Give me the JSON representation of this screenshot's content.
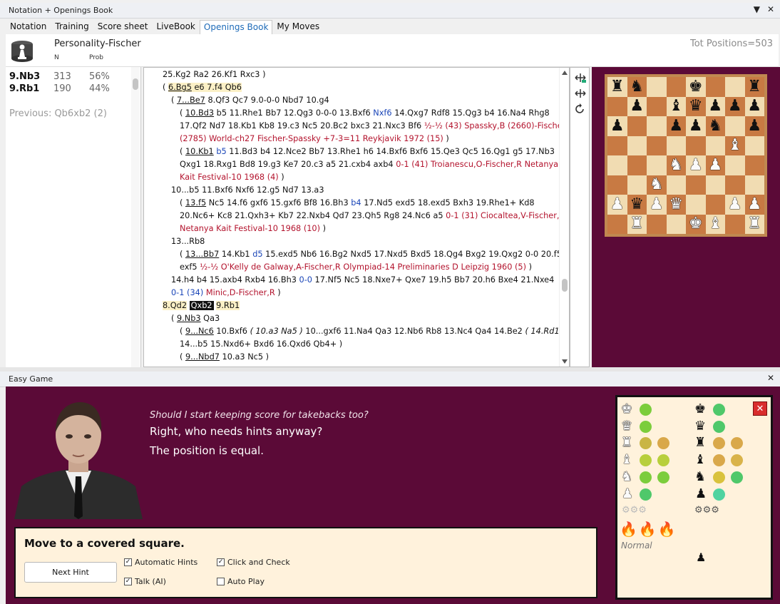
{
  "top_panel": {
    "title": "Notation + Openings Book",
    "pin_icon": "▼",
    "close_icon": "✕",
    "tabs": [
      "Notation",
      "Training",
      "Score sheet",
      "LiveBook",
      "Openings Book",
      "My Moves"
    ],
    "active_tab": "Openings Book"
  },
  "book": {
    "name": "Personality-Fischer",
    "col_n": "N",
    "col_prob": "Prob",
    "tot_positions": "Tot Positions=503",
    "moves": [
      {
        "move": "9.Nb3",
        "n": "313",
        "prob": "56%"
      },
      {
        "move": "9.Rb1",
        "n": "190",
        "prob": "44%"
      }
    ],
    "previous": "Previous: Qb6xb2 (2)"
  },
  "notation": {
    "l1": "25.Kg2  Ra2  26.Kf1  Rxc3 )",
    "l2_open": "( ",
    "l2_m1": "6.Bg5",
    "l2_m2": " e6  7.f4  Qb6",
    "l3_open": "( ",
    "l3_m1": "7...Be7",
    "l3_rest": "  8.Qf3  Qc7  9.0-0-0  Nbd7  10.g4",
    "l4_open": "( ",
    "l4_m1": "10.Bd3",
    "l4_rest": "  b5  11.Rhe1  Bb7  12.Qg3  0-0-0  13.Bxf6  ",
    "l4_blue": "Nxf6",
    "l4_end": "  14.Qxg7  Rdf8  15.Qg3  b4  16.Na4  Rhg8",
    "l5_a": "17.Qf2  Nd7  18.Kb1  Kb8  19.c3  Nc5  20.Bc2  bxc3  21.Nxc3  Bf6 ",
    "l5_red": "½-½ (43) Spassky,B (2660)-Fischer,R",
    "l6_red": "(2785) World-ch27 Fischer-Spassky +7-3=11 Reykjavik 1972 (15)",
    "l6_end": " )",
    "l7_open": "( ",
    "l7_m1": "10.Kb1",
    "l7_sp": "  ",
    "l7_blue": "b5",
    "l7_rest": "  11.Bd3  b4  12.Nce2  Bb7  13.Rhe1  h6  14.Bxf6  Bxf6  15.Qe3  Qc5  16.Qg1  g5  17.Nb3",
    "l8_a": "Qxg1  18.Rxg1  Bd8  19.g3  Ke7  20.c3  a5  21.cxb4  axb4 ",
    "l8_red": "0-1 (41) Troianescu,O-Fischer,R Netanya",
    "l9_red": "Kait Festival-10 1968 (4)",
    "l9_end": " )",
    "l10": "10...b5  11.Bxf6  Nxf6  12.g5  Nd7  13.a3",
    "l11_open": "( ",
    "l11_m1": "13.f5",
    "l11_a": "  Nc5  14.f6  gxf6  15.gxf6  Bf8  16.Bh3  ",
    "l11_blue": "b4",
    "l11_b": "  17.Nd5  exd5  18.exd5  Bxh3  19.Rhe1+  Kd8",
    "l12_a": "20.Nc6+  Kc8  21.Qxh3+  Kb7  22.Nxb4  Qd7  23.Qh5  Rg8  24.Nc6  a5 ",
    "l12_red": "0-1 (31) Ciocaltea,V-Fischer,R",
    "l13_red": "Netanya Kait Festival-10 1968 (10)",
    "l13_end": "  )",
    "l14": "13...Rb8",
    "l15_open": "( ",
    "l15_m1": "13...Bb7",
    "l15_a": "  14.Kb1  ",
    "l15_blue": "d5",
    "l15_b": "  15.exd5  Nb6  16.Bg2  Nxd5  17.Nxd5  Bxd5  18.Qg4  Bxg2  19.Qxg2  0-0  20.f5",
    "l16_a": "exf5 ",
    "l16_red": "½-½ O'Kelly de Galway,A-Fischer,R Olympiad-14 Preliminaries D Leipzig 1960 (5)",
    "l16_end": "  )",
    "l17": "14.h4  b4  15.axb4  Rxb4  16.Bh3  ",
    "l17_blue": "0-0",
    "l17_b": "  17.Nf5  Nc5  18.Nxe7+  Qxe7  19.h5  Bb7  20.h6  Bxe4  21.Nxe4",
    "l18_blue": "0-1 (34)",
    "l18_red": " Minic,D-Fischer,R",
    "l18_end": " )",
    "l19_a": "8.Qd2",
    "l19_cur": "Qxb2",
    "l19_b": "9.Rb1",
    "l20_open": "( ",
    "l20_m1": "9.Nb3",
    "l20_b": "  Qa3",
    "l21_open": "( ",
    "l21_m1": "9...Nc6",
    "l21_a": "  10.Bxf6  ",
    "l21_it1": "( 10.a3  Na5 )",
    "l21_b": "  10...gxf6  11.Na4  Qa3  12.Nb6  Rb8  13.Nc4  Qa4  14.Be2  ",
    "l21_it2": "( 14.Rd1 )",
    "l22": "14...b5  15.Nxd6+  Bxd6  16.Qxd6  Qb4+ )",
    "l23_open": "( ",
    "l23_m1": "9...Nbd7",
    "l23_b": "  10.a3  Nc5 )"
  },
  "board": {
    "rows": [
      [
        "r",
        "n",
        "",
        "",
        "k",
        "",
        "",
        "r"
      ],
      [
        "",
        "p",
        "",
        "b",
        "q",
        "p",
        "p",
        "p"
      ],
      [
        "p",
        "",
        "",
        "p",
        "p",
        "n",
        "",
        "p"
      ],
      [
        "",
        "",
        "",
        "",
        "",
        "",
        "B",
        ""
      ],
      [
        "",
        "",
        "",
        "N",
        "P",
        "P",
        "",
        ""
      ],
      [
        "",
        "",
        "N",
        "",
        "",
        "",
        "",
        ""
      ],
      [
        "P",
        "q",
        "P",
        "Q",
        "",
        "",
        "P",
        "P"
      ],
      [
        "",
        "R",
        "",
        "",
        "K",
        "B",
        "",
        "R"
      ]
    ]
  },
  "easy": {
    "title": "Easy Game",
    "close_icon": "✕",
    "line1": "Should I start keeping score for takebacks too?",
    "line2": "Right, who needs hints anyway?",
    "line3": "The position is equal.",
    "hint_title": "Move to a covered square.",
    "next_hint": "Next Hint",
    "cb_auto_hints": "Automatic Hints",
    "cb_click_check": "Click and Check",
    "cb_talk": "Talk (AI)",
    "cb_auto_play": "Auto Play",
    "check_glyph": "✓",
    "gears_white": "⚙⚙⚙",
    "gears_black": "⚙⚙⚙",
    "fires": "🔥🔥🔥",
    "level": "Normal",
    "close_x": "✕",
    "colors": {
      "green": "#7ccd3c",
      "orange": "#d9a84a",
      "yellowgreen": "#b8cf3c",
      "teal": "#4fd3a0",
      "bg": "#5b0a37"
    }
  }
}
